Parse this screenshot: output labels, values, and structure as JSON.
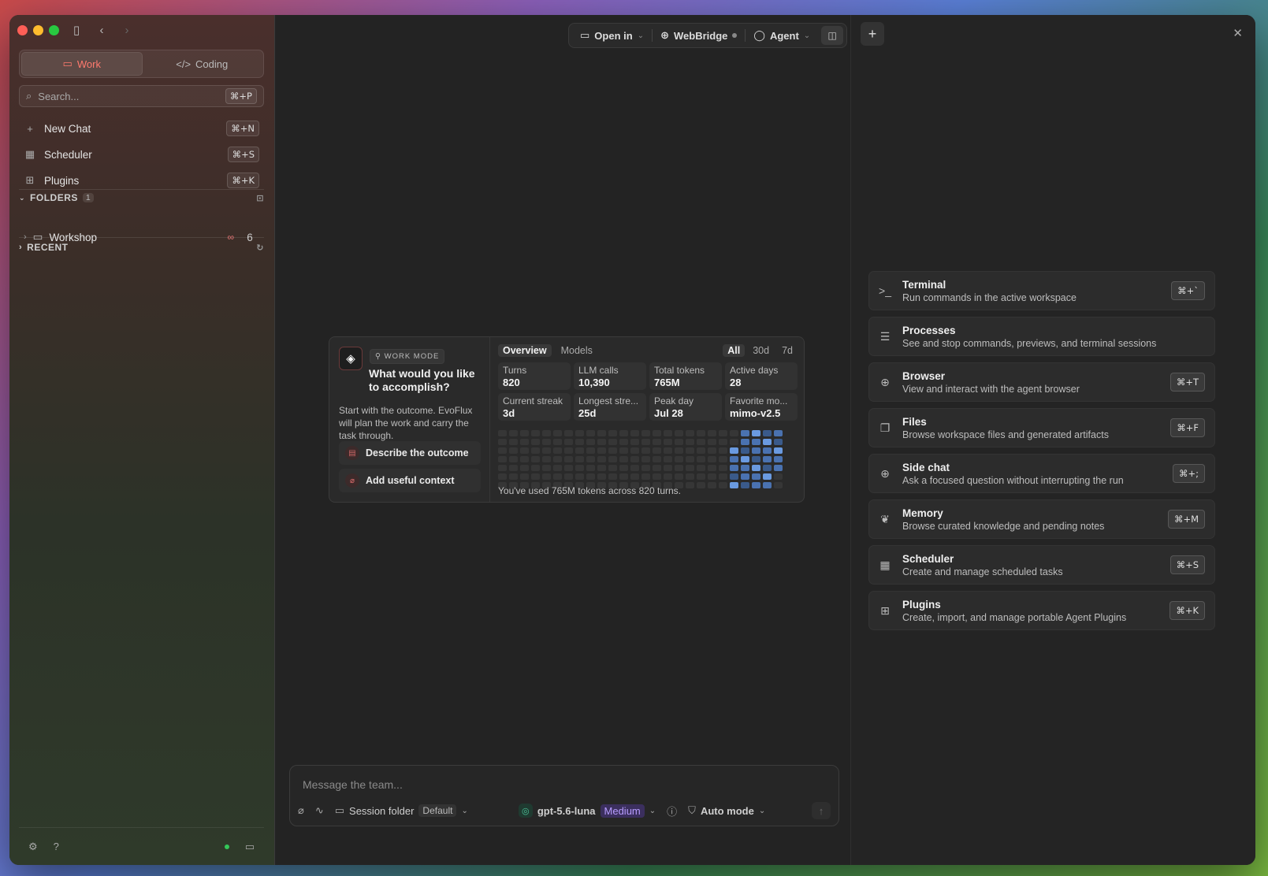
{
  "sidebar": {
    "modes": [
      {
        "label": "Work",
        "active": true
      },
      {
        "label": "Coding",
        "active": false
      }
    ],
    "search": {
      "placeholder": "Search...",
      "shortcut": "⌘+P"
    },
    "nav": [
      {
        "label": "New Chat",
        "shortcut": "⌘+N",
        "icon": "plus-icon"
      },
      {
        "label": "Scheduler",
        "shortcut": "⌘+S",
        "icon": "calendar-icon"
      },
      {
        "label": "Plugins",
        "shortcut": "⌘+K",
        "icon": "plugin-icon"
      }
    ],
    "folders": {
      "title": "FOLDERS",
      "count": "1",
      "items": [
        {
          "name": "Workshop",
          "count": "6"
        }
      ]
    },
    "recent": {
      "title": "RECENT"
    }
  },
  "toolbar": {
    "open_in": "Open in",
    "webbridge": "WebBridge",
    "agent": "Agent"
  },
  "card": {
    "badge": "WORK MODE",
    "title": "What would you like to accomplish?",
    "description": "Start with the outcome. EvoFlux will plan the work and carry the task through.",
    "actions": [
      "Describe the outcome",
      "Add useful context"
    ],
    "tabs": [
      "Overview",
      "Models"
    ],
    "ranges": [
      "All",
      "30d",
      "7d"
    ],
    "stats": [
      {
        "label": "Turns",
        "value": "820"
      },
      {
        "label": "LLM calls",
        "value": "10,390"
      },
      {
        "label": "Total tokens",
        "value": "765M"
      },
      {
        "label": "Active days",
        "value": "28"
      },
      {
        "label": "Current streak",
        "value": "3d"
      },
      {
        "label": "Longest stre...",
        "value": "25d"
      },
      {
        "label": "Peak day",
        "value": "Jul 28"
      },
      {
        "label": "Favorite mo...",
        "value": "mimo-v2.5"
      }
    ],
    "usage": "You've used 765M tokens across 820 turns."
  },
  "composer": {
    "placeholder": "Message the team...",
    "session_folder": "Session folder",
    "folder_value": "Default",
    "model": "gpt-5.6-luna",
    "effort": "Medium",
    "mode": "Auto mode"
  },
  "tools": [
    {
      "title": "Terminal",
      "desc": "Run commands in the active workspace",
      "shortcut": "⌘+`",
      "icon": "terminal-icon"
    },
    {
      "title": "Processes",
      "desc": "See and stop commands, previews, and terminal sessions",
      "shortcut": "",
      "icon": "list-icon"
    },
    {
      "title": "Browser",
      "desc": "View and interact with the agent browser",
      "shortcut": "⌘+T",
      "icon": "globe-icon"
    },
    {
      "title": "Files",
      "desc": "Browse workspace files and generated artifacts",
      "shortcut": "⌘+F",
      "icon": "files-icon"
    },
    {
      "title": "Side chat",
      "desc": "Ask a focused question without interrupting the run",
      "shortcut": "⌘+;",
      "icon": "chat-plus-icon"
    },
    {
      "title": "Memory",
      "desc": "Browse curated knowledge and pending notes",
      "shortcut": "⌘+M",
      "icon": "brain-icon"
    },
    {
      "title": "Scheduler",
      "desc": "Create and manage scheduled tasks",
      "shortcut": "⌘+S",
      "icon": "calendar-icon"
    },
    {
      "title": "Plugins",
      "desc": "Create, import, and manage portable Agent Plugins",
      "shortcut": "⌘+K",
      "icon": "plugin-icon"
    }
  ]
}
